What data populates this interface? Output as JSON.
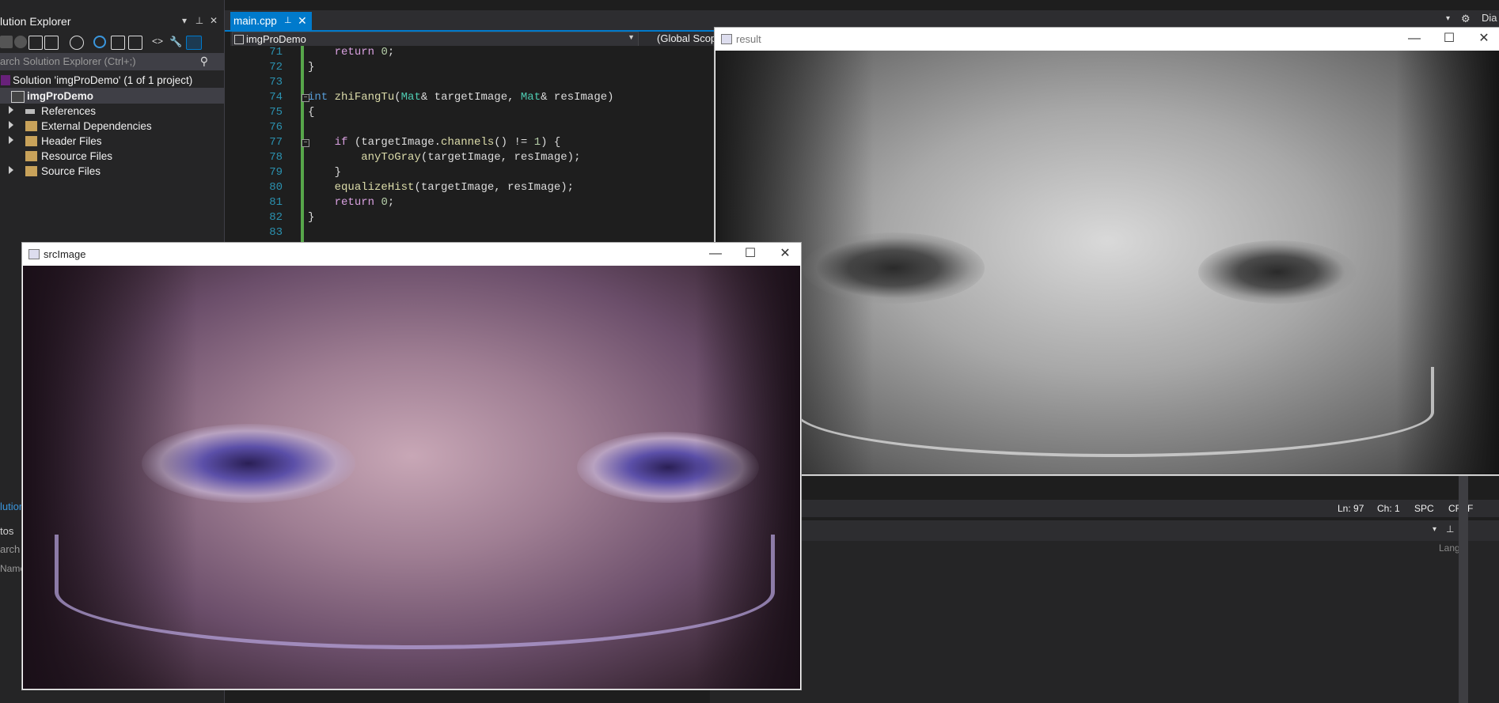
{
  "solution_explorer": {
    "title": "lution Explorer",
    "search_placeholder": "arch Solution Explorer (Ctrl+;)",
    "tree": [
      {
        "label": "Solution 'imgProDemo' (1 of 1 project)"
      },
      {
        "label": "imgProDemo"
      },
      {
        "label": "References"
      },
      {
        "label": "External Dependencies"
      },
      {
        "label": "Header Files"
      },
      {
        "label": "Resource Files"
      },
      {
        "label": "Source Files"
      }
    ],
    "lower_labels": {
      "solution_tab": "lution",
      "autos": "tos",
      "search": "arch",
      "name": "Name"
    }
  },
  "editor": {
    "tab_label": "main.cpp",
    "project_dropdown": "imgProDemo",
    "scope_dropdown": "(Global Scop",
    "line_numbers": [
      "71",
      "72",
      "73",
      "74",
      "75",
      "76",
      "77",
      "78",
      "79",
      "80",
      "81",
      "82",
      "83"
    ],
    "accent_color": "#007acc"
  },
  "windows": {
    "result": {
      "title": "result"
    },
    "src": {
      "title": "srcImage"
    }
  },
  "status": {
    "ln": "Ln: 97",
    "ch": "Ch: 1",
    "spc": "SPC",
    "crlf": "CRLF"
  },
  "output": {
    "lang": "Lang",
    "right_edge": "Dia"
  }
}
